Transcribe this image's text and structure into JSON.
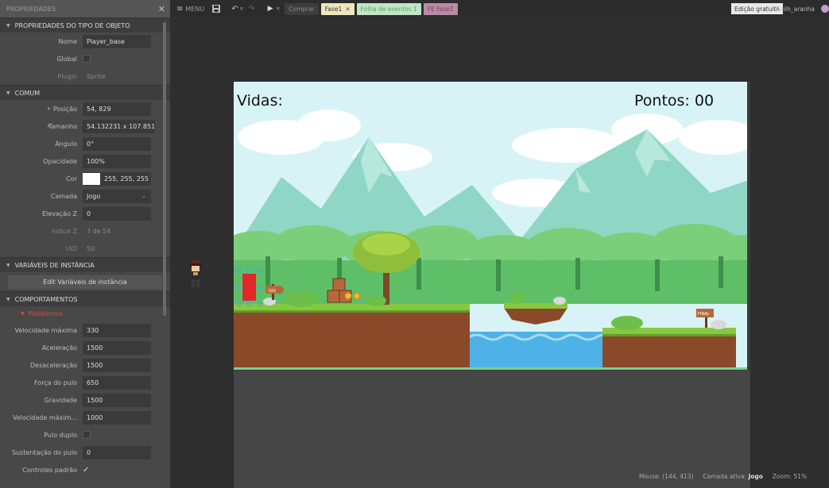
{
  "panel": {
    "title": "PROPRIEDADES",
    "close": "✕",
    "object_type_section": "PROPRIEDADES DO TIPO DE OBJETO",
    "object_type": [
      {
        "label": "Nome",
        "value": "Player_base"
      },
      {
        "label": "Global",
        "value": ""
      },
      {
        "label": "Plugin",
        "value": "Sprite"
      }
    ],
    "common_section": "COMUM",
    "common": {
      "position_label": "Posição",
      "position": "54, 829",
      "size_label": "Tamanho",
      "size": "54.132231  x 107.851",
      "angle_label": "Ângulo",
      "angle": "0°",
      "opacity_label": "Opacidade",
      "opacity": "100%",
      "color_label": "Cor",
      "color": "255, 255, 255",
      "layer_label": "Camada",
      "layer": "Jogo",
      "z_elev_label": "Elevação Z",
      "z_elev": "0",
      "z_index_label": "Índice Z",
      "z_index": "7 de 54",
      "uid_label": "UID",
      "uid": "50"
    },
    "instance_vars_section": "VARIÁVEIS DE INSTÂNCIA",
    "instance_vars_button": "Edit Variáveis de instância",
    "behaviors_section": "COMPORTAMENTOS",
    "behavior_name": "Plataforma",
    "behavior": [
      {
        "label": "Velocidade máxima",
        "value": "330"
      },
      {
        "label": "Aceleração",
        "value": "1500"
      },
      {
        "label": "Desaceleração",
        "value": "1500"
      },
      {
        "label": "Força do pulo",
        "value": "650"
      },
      {
        "label": "Gravidade",
        "value": "1500"
      },
      {
        "label": "Velocidade máxim...",
        "value": "1000"
      },
      {
        "label": "Pulo duplo",
        "value": ""
      },
      {
        "label": "Sustentação do pulo",
        "value": "0"
      },
      {
        "label": "Controles padrão",
        "value": "✓"
      }
    ]
  },
  "toolbar": {
    "menu": "MENU",
    "buy": "Comprar",
    "tabs": {
      "fase": "Fase1",
      "fase_close": "✕",
      "folha": "Folha de eventos 1",
      "fe": "FE Fase1"
    },
    "edition": "Edição gratuita",
    "user": "Guiih_aranha"
  },
  "scene": {
    "lives": "Vidas:",
    "points": "Pontos: 00",
    "sign_go": "GO!",
    "sign_final": "FINAL"
  },
  "status": {
    "mouse": "Mouse: (144, 413)",
    "layer_label": "Camada ativa:",
    "layer": "Jogo",
    "zoom": "Zoom: 51%"
  },
  "colors": {
    "sky": "#d8f3f6",
    "mountains": "#8fd7c4",
    "trees": "#7ccf7a",
    "ground": "#8a4a2a",
    "grass": "#86c93f",
    "water": "#4fb2e6"
  }
}
